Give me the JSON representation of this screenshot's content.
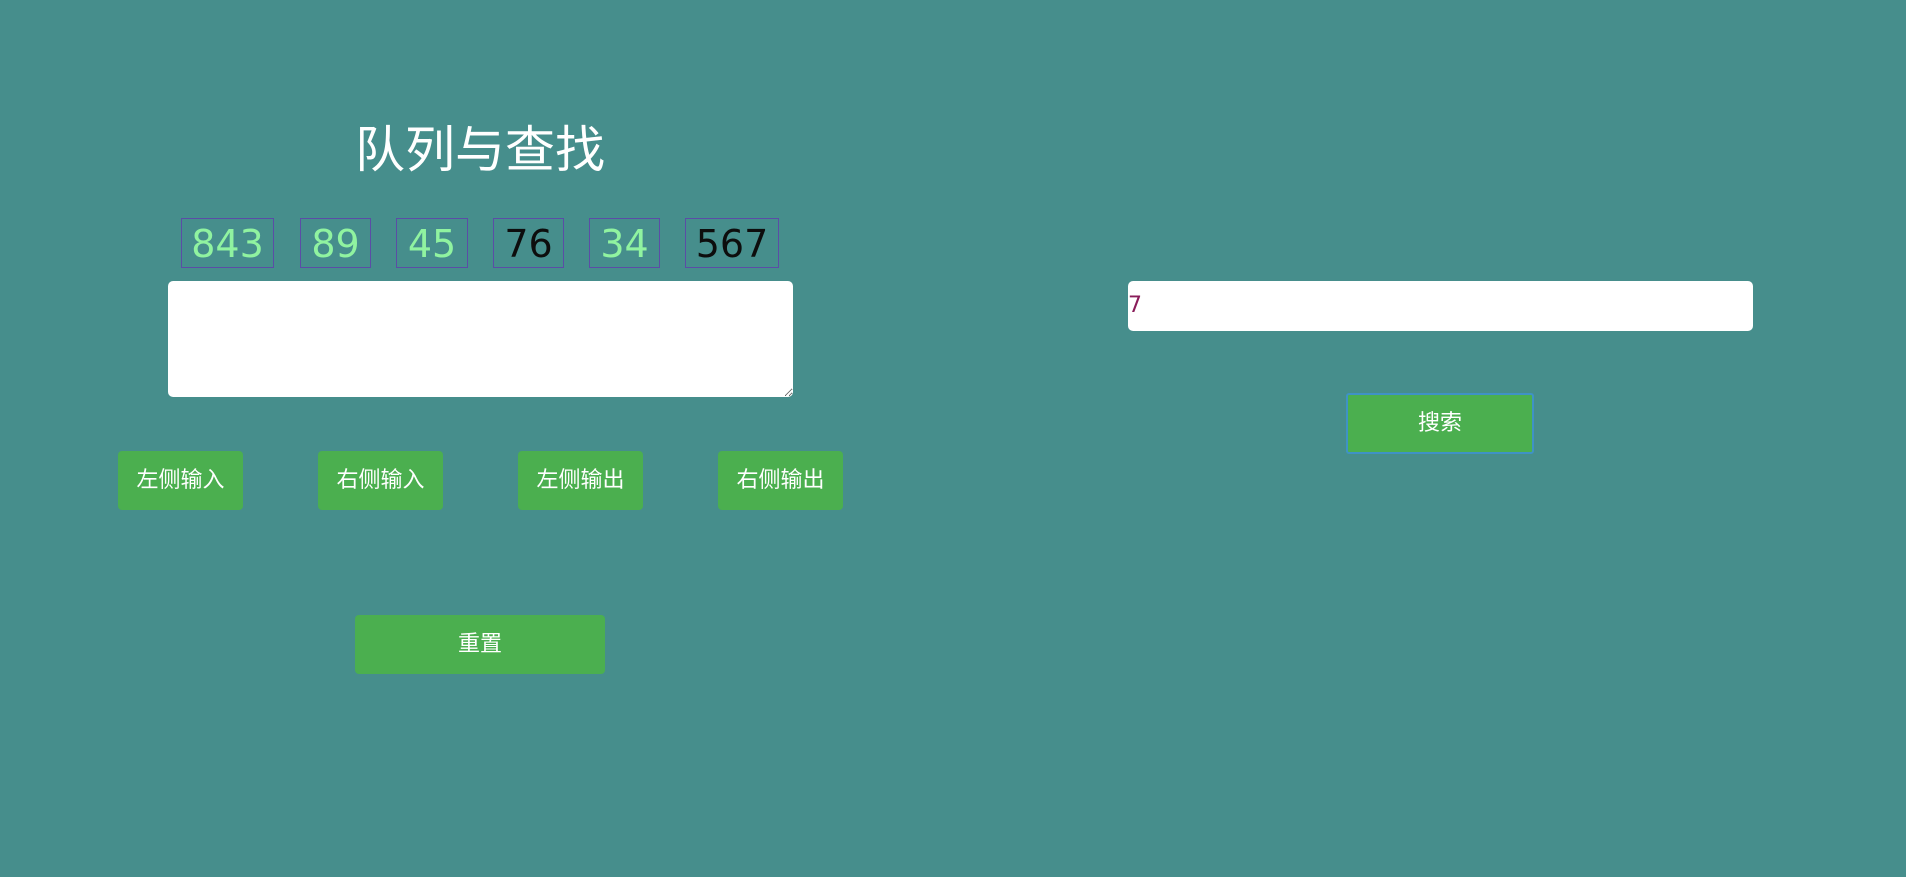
{
  "title": "队列与查找",
  "queue": [
    {
      "value": "843",
      "color": "green"
    },
    {
      "value": "89",
      "color": "green"
    },
    {
      "value": "45",
      "color": "green"
    },
    {
      "value": "76",
      "color": "dark"
    },
    {
      "value": "34",
      "color": "green"
    },
    {
      "value": "567",
      "color": "dark"
    }
  ],
  "input": {
    "value": ""
  },
  "buttons": {
    "left_in": "左侧输入",
    "right_in": "右侧输入",
    "left_out": "左侧输出",
    "right_out": "右侧输出",
    "reset": "重置"
  },
  "search": {
    "value": "7",
    "button": "搜索"
  },
  "colors": {
    "background": "#468e8c",
    "button": "#4baf4f",
    "highlight_text": "#90f3a0",
    "normal_text": "#0d0d0d",
    "item_border": "#5b4da6",
    "search_border": "#3f92c5",
    "search_text": "#8a1d5a"
  }
}
